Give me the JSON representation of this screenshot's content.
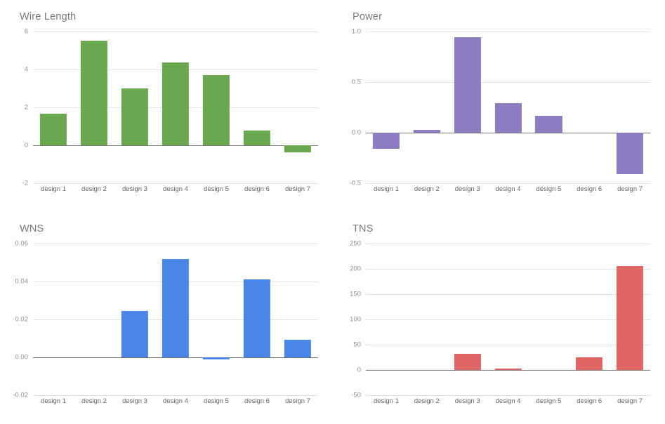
{
  "layout": {
    "rows": 2,
    "cols": 2,
    "panel_order": [
      "wire_length",
      "power",
      "wns",
      "tns"
    ]
  },
  "colors": {
    "green": "#6aa84f",
    "purple": "#8e7cc3",
    "blue": "#4a86e8",
    "red": "#e06666",
    "gridline": "#e2e2e2",
    "axis": "#777777",
    "title_text": "#7b7b7b",
    "tick_text": "#8d8d8d",
    "category_text": "#666666"
  },
  "chart_data": [
    {
      "id": "wire_length",
      "type": "bar",
      "title": "Wire Length",
      "xlabel": "",
      "ylabel": "",
      "categories": [
        "design 1",
        "design 2",
        "design 3",
        "design 4",
        "design 5",
        "design 6",
        "design 7"
      ],
      "values": [
        1.65,
        5.52,
        3.0,
        4.37,
        3.72,
        0.78,
        -0.38
      ],
      "ylim": [
        -2,
        6
      ],
      "yticks": [
        6,
        4,
        2,
        0,
        -2
      ],
      "ytick_labels": [
        "6",
        "4",
        "2",
        "0",
        "-2"
      ],
      "zero_line": 0,
      "grid": true,
      "legend": "none",
      "color": "#6aa84f"
    },
    {
      "id": "power",
      "type": "bar",
      "title": "Power",
      "xlabel": "",
      "ylabel": "",
      "categories": [
        "design 1",
        "design 2",
        "design 3",
        "design 4",
        "design 5",
        "design 6",
        "design 7"
      ],
      "values": [
        -0.16,
        0.03,
        0.945,
        0.29,
        0.165,
        0.0,
        -0.41
      ],
      "ylim": [
        -0.5,
        1.0
      ],
      "yticks": [
        1.0,
        0.5,
        0.0,
        -0.5
      ],
      "ytick_labels": [
        "1.0",
        "0.5",
        "0.0",
        "-0.5"
      ],
      "zero_line": 0,
      "grid": true,
      "legend": "none",
      "color": "#8e7cc3"
    },
    {
      "id": "wns",
      "type": "bar",
      "title": "WNS",
      "xlabel": "",
      "ylabel": "",
      "categories": [
        "design 1",
        "design 2",
        "design 3",
        "design 4",
        "design 5",
        "design 6",
        "design 7"
      ],
      "values": [
        0.0,
        0.0,
        0.0245,
        0.052,
        -0.0012,
        0.041,
        0.0093
      ],
      "ylim": [
        -0.02,
        0.06
      ],
      "yticks": [
        0.06,
        0.04,
        0.02,
        0.0,
        -0.02
      ],
      "ytick_labels": [
        "0.06",
        "0.04",
        "0.02",
        "0.00",
        "-0.02"
      ],
      "zero_line": 0,
      "grid": true,
      "legend": "none",
      "color": "#4a86e8"
    },
    {
      "id": "tns",
      "type": "bar",
      "title": "TNS",
      "xlabel": "",
      "ylabel": "",
      "categories": [
        "design 1",
        "design 2",
        "design 3",
        "design 4",
        "design 5",
        "design 6",
        "design 7"
      ],
      "values": [
        0,
        0,
        32,
        3,
        0,
        25,
        206
      ],
      "ylim": [
        -50,
        250
      ],
      "yticks": [
        250,
        200,
        150,
        100,
        50,
        0,
        -50
      ],
      "ytick_labels": [
        "250",
        "200",
        "150",
        "100",
        "50",
        "0",
        "-50"
      ],
      "zero_line": 0,
      "grid": true,
      "legend": "none",
      "color": "#e06666"
    }
  ]
}
